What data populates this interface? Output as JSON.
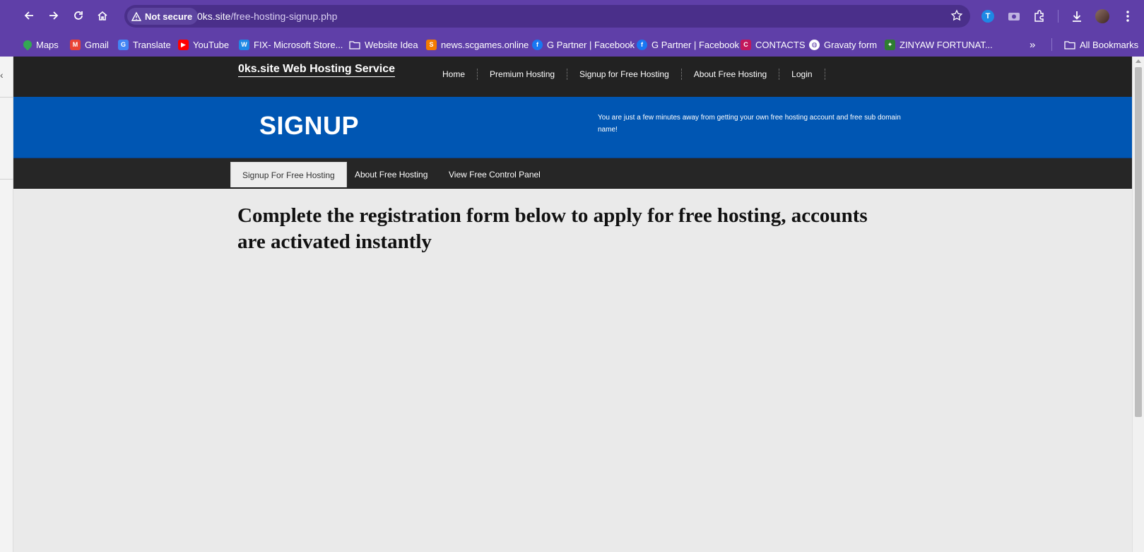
{
  "browser": {
    "security_label": "Not secure",
    "url_host": "0ks.site",
    "url_path": "/free-hosting-signup.php",
    "theme_color": "#5f3fa8"
  },
  "bookmarks": [
    {
      "label": "Maps",
      "icon": "maps-icon"
    },
    {
      "label": "Gmail",
      "icon": "gmail-icon"
    },
    {
      "label": "Translate",
      "icon": "translate-icon"
    },
    {
      "label": "YouTube",
      "icon": "youtube-icon"
    },
    {
      "label": "FIX- Microsoft Store...",
      "icon": "w-icon"
    },
    {
      "label": "Website Idea",
      "icon": "folder-icon"
    },
    {
      "label": "news.scgames.online",
      "icon": "scgames-icon"
    },
    {
      "label": "G Partner | Facebook",
      "icon": "facebook-icon"
    },
    {
      "label": "G Partner | Facebook",
      "icon": "facebook-icon"
    },
    {
      "label": "CONTACTS",
      "icon": "contacts-icon"
    },
    {
      "label": "Gravaty form",
      "icon": "globe-icon"
    },
    {
      "label": "ZINYAW FORTUNAT...",
      "icon": "bird-icon"
    }
  ],
  "all_bookmarks_label": "All Bookmarks",
  "site": {
    "brand": "0ks.site Web Hosting Service",
    "nav": [
      "Home",
      "Premium Hosting",
      "Signup for Free Hosting",
      "About Free Hosting",
      "Login"
    ],
    "banner_title": "SIGNUP",
    "banner_text": "You are just a few minutes away from getting your own free hosting account and free sub domain name!",
    "tabs": [
      "Signup For Free Hosting",
      "About Free Hosting",
      "View Free Control Panel"
    ],
    "headline": "Complete the registration form below to apply for free hosting, accounts are activated instantly",
    "colors": {
      "header": "#222222",
      "banner": "#0056b3",
      "subnav": "#262626",
      "body": "#eaeaea"
    }
  }
}
